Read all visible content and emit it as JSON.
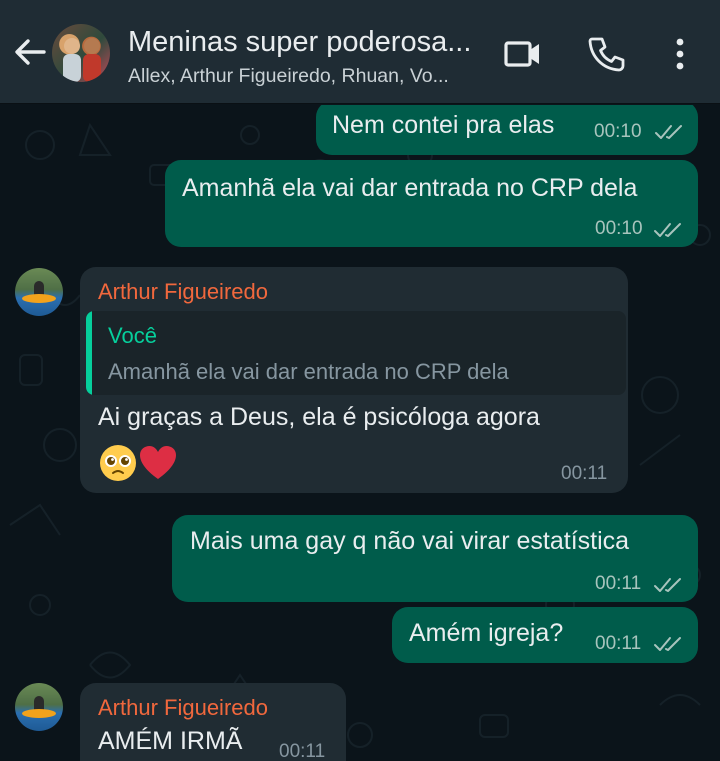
{
  "header": {
    "back_icon": "arrow-left-icon",
    "title": "Meninas super poderosa...",
    "subtitle": "Allex, Arthur Figueiredo, Rhuan, Vo...",
    "video_icon": "video-camera-icon",
    "call_icon": "phone-icon",
    "menu_icon": "more-vertical-icon"
  },
  "messages": [
    {
      "direction": "out",
      "text": "Nem contei pra elas",
      "time": "00:10",
      "status": "read"
    },
    {
      "direction": "out",
      "text": "Amanhã ela vai dar entrada no CRP dela",
      "time": "00:10",
      "status": "read"
    },
    {
      "direction": "in",
      "sender": "Arthur Figueiredo",
      "quote": {
        "author": "Você",
        "text": "Amanhã ela vai dar entrada no CRP dela"
      },
      "text": "Ai graças a Deus, ela é psicóloga agora",
      "emojis": [
        "pleading-face",
        "red-heart"
      ],
      "time": "00:11"
    },
    {
      "direction": "out",
      "text": "Mais uma gay q não vai virar estatística",
      "time": "00:11",
      "status": "read"
    },
    {
      "direction": "out",
      "text": "Amém igreja?",
      "time": "00:11",
      "status": "read"
    },
    {
      "direction": "in",
      "sender": "Arthur Figueiredo",
      "text": "AMÉM IRMÃ",
      "time": "00:11"
    }
  ],
  "colors": {
    "header_bg": "#1f2c34",
    "chat_bg": "#0b141a",
    "outgoing_bubble": "#005c4b",
    "incoming_bubble": "#202c33",
    "sender_name": "#f1683d",
    "quote_accent": "#06cf9c",
    "read_ticks": "#a8c4bd"
  }
}
